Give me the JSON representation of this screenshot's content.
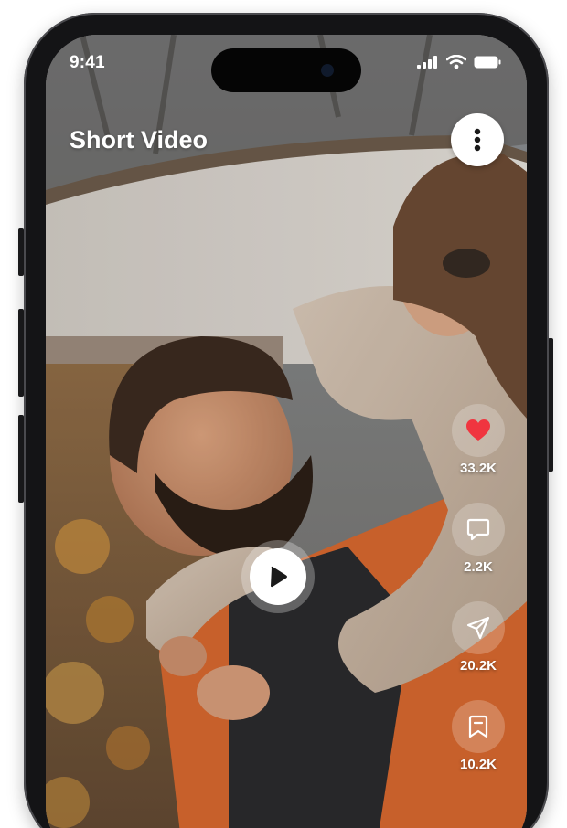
{
  "status_bar": {
    "time": "9:41",
    "icons": [
      "signal-icon",
      "wifi-icon",
      "battery-icon"
    ]
  },
  "header": {
    "title": "Short Video",
    "more_icon": "more-vertical-icon"
  },
  "video": {
    "subject": "photo",
    "play_icon": "play-icon"
  },
  "actions": [
    {
      "name": "like",
      "icon": "heart-icon",
      "count": "33.2K"
    },
    {
      "name": "comment",
      "icon": "comment-icon",
      "count": "2.2K"
    },
    {
      "name": "share",
      "icon": "send-icon",
      "count": "20.2K"
    },
    {
      "name": "save",
      "icon": "bookmark-icon",
      "count": "10.2K"
    }
  ],
  "colors": {
    "accent_like": "#f0353f",
    "text": "#ffffff",
    "frame": "#141416"
  }
}
